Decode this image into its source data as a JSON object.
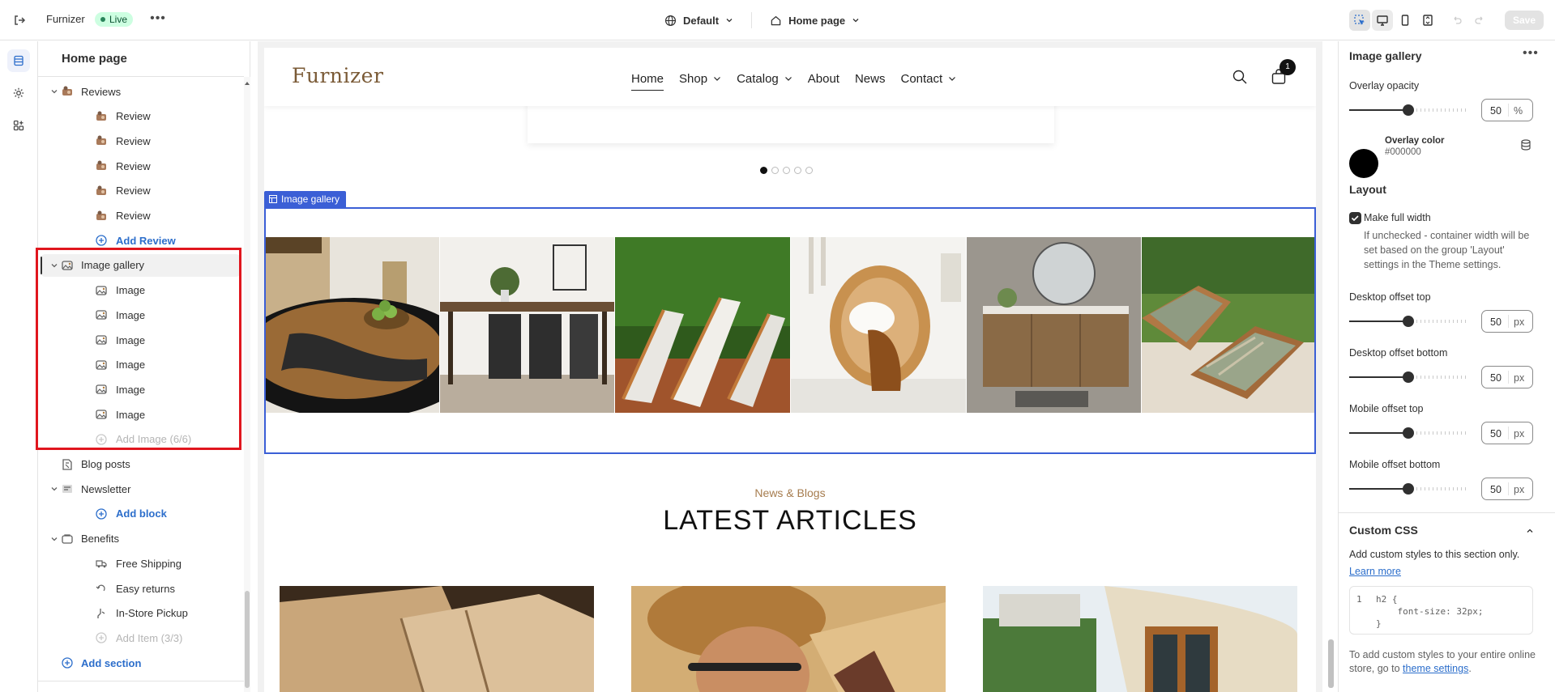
{
  "topbar": {
    "store_name": "Furnizer",
    "status": "Live",
    "more": "•••",
    "theme_dropdown": "Default",
    "page_dropdown": "Home page",
    "save_label": "Save"
  },
  "sidebar": {
    "title": "Home page",
    "items": [
      {
        "label": "Reviews",
        "kind": "section"
      },
      {
        "label": "Review",
        "kind": "block"
      },
      {
        "label": "Review",
        "kind": "block"
      },
      {
        "label": "Review",
        "kind": "block"
      },
      {
        "label": "Review",
        "kind": "block"
      },
      {
        "label": "Review",
        "kind": "block"
      },
      {
        "label": "Add Review",
        "kind": "add"
      },
      {
        "label": "Image gallery",
        "kind": "section",
        "selected": true
      },
      {
        "label": "Image",
        "kind": "block"
      },
      {
        "label": "Image",
        "kind": "block"
      },
      {
        "label": "Image",
        "kind": "block"
      },
      {
        "label": "Image",
        "kind": "block"
      },
      {
        "label": "Image",
        "kind": "block"
      },
      {
        "label": "Image",
        "kind": "block"
      },
      {
        "label": "Add Image (6/6)",
        "kind": "add-disabled"
      },
      {
        "label": "Blog posts",
        "kind": "section"
      },
      {
        "label": "Newsletter",
        "kind": "section"
      },
      {
        "label": "Add block",
        "kind": "add"
      },
      {
        "label": "Benefits",
        "kind": "section"
      },
      {
        "label": "Free Shipping",
        "kind": "block"
      },
      {
        "label": "Easy returns",
        "kind": "block"
      },
      {
        "label": "In-Store Pickup",
        "kind": "block"
      },
      {
        "label": "Add Item (3/3)",
        "kind": "add-disabled"
      },
      {
        "label": "Add section",
        "kind": "add"
      }
    ]
  },
  "preview": {
    "logo": "Furnizer",
    "nav": [
      "Home",
      "Shop",
      "Catalog",
      "About",
      "News",
      "Contact"
    ],
    "cart_count": "1",
    "section_tag": "Image gallery",
    "news_subtitle": "News & Blogs",
    "news_title": "LATEST ARTICLES"
  },
  "panel": {
    "title": "Image gallery",
    "overlay_opacity_label": "Overlay opacity",
    "overlay_opacity_value": "50",
    "overlay_opacity_unit": "%",
    "overlay_color_label": "Overlay color",
    "overlay_color_value": "#000000",
    "layout_heading": "Layout",
    "full_width_label": "Make full width",
    "full_width_help": "If unchecked - container width will be set based on the group 'Layout' settings in the Theme settings.",
    "desktop_top_label": "Desktop offset top",
    "desktop_top_value": "50",
    "desktop_bottom_label": "Desktop offset bottom",
    "desktop_bottom_value": "50",
    "mobile_top_label": "Mobile offset top",
    "mobile_top_value": "50",
    "mobile_bottom_label": "Mobile offset bottom",
    "mobile_bottom_value": "50",
    "px_unit": "px",
    "css_heading": "Custom CSS",
    "css_help": "Add custom styles to this section only.",
    "learn_more": "Learn more",
    "code_line_number": "1",
    "code_line1": "h2 {",
    "code_line2": "    font-size: 32px;",
    "code_line3": "}",
    "bottom_text": "To add custom styles to your entire online store, go to",
    "bottom_link": "theme settings",
    "bottom_period": "."
  },
  "colors": {
    "accent": "#2c6ecb",
    "selection": "#3b5fd6",
    "brand": "#a67c4e",
    "highlight": "#e0161e"
  }
}
